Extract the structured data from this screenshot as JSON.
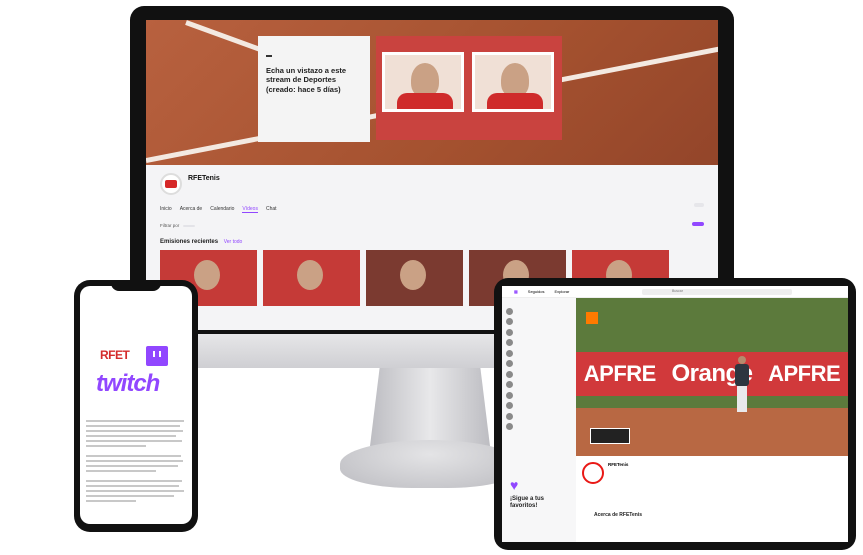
{
  "monitor": {
    "banner": {
      "tag": "",
      "headline": "Echa un vistazo a este stream de Deportes (creado: hace 5 días)",
      "small_text": "",
      "stream_label": ""
    },
    "channel": {
      "name": "RFETenis",
      "subtitle": ""
    },
    "nav": [
      "Inicio",
      "Acerca de",
      "Calendario",
      "Vídeos",
      "Chat"
    ],
    "follow_label": "",
    "filter_label": "Filtrar por",
    "filter_value": "",
    "purple_button": "",
    "section_title": "Emisiones recientes",
    "section_link": "Ver todo",
    "thumbnails": [
      {
        "meta": ""
      },
      {
        "meta": ""
      },
      {
        "meta": ""
      },
      {
        "meta": ""
      },
      {
        "meta": ""
      }
    ]
  },
  "phone": {
    "header": "",
    "rfet_logo": "RFET",
    "rfet_logo_sub": "",
    "twitch_logo": "twitch"
  },
  "tablet": {
    "topbar": [
      "Seguidos",
      "Explorar"
    ],
    "search_placeholder": "Buscar",
    "sidebar": [
      {
        "name": "",
        "viewers": ""
      },
      {
        "name": "",
        "viewers": ""
      },
      {
        "name": "",
        "viewers": ""
      },
      {
        "name": "",
        "viewers": ""
      },
      {
        "name": "",
        "viewers": ""
      },
      {
        "name": "",
        "viewers": ""
      },
      {
        "name": "",
        "viewers": ""
      },
      {
        "name": "",
        "viewers": ""
      },
      {
        "name": "",
        "viewers": ""
      },
      {
        "name": "",
        "viewers": ""
      },
      {
        "name": "",
        "viewers": ""
      },
      {
        "name": "",
        "viewers": ""
      }
    ],
    "join_title": "¡Sigue a tus favoritos!",
    "join_sub": "",
    "video": {
      "hoarding_left": "APFRE",
      "hoarding_center": "Orange",
      "hoarding_right": "APFRE"
    },
    "info": {
      "channel_name": "RFETenis",
      "stream_title": "",
      "about_title": "Acerca de RFETenis",
      "about_sub": "",
      "links": [
        "",
        "",
        ""
      ]
    }
  },
  "colors": {
    "twitch_purple": "#9147ff",
    "clay": "#b86843",
    "brand_red": "#d62828"
  },
  "icons": [
    "twitch-logo-icon",
    "heart-icon",
    "search-icon"
  ]
}
